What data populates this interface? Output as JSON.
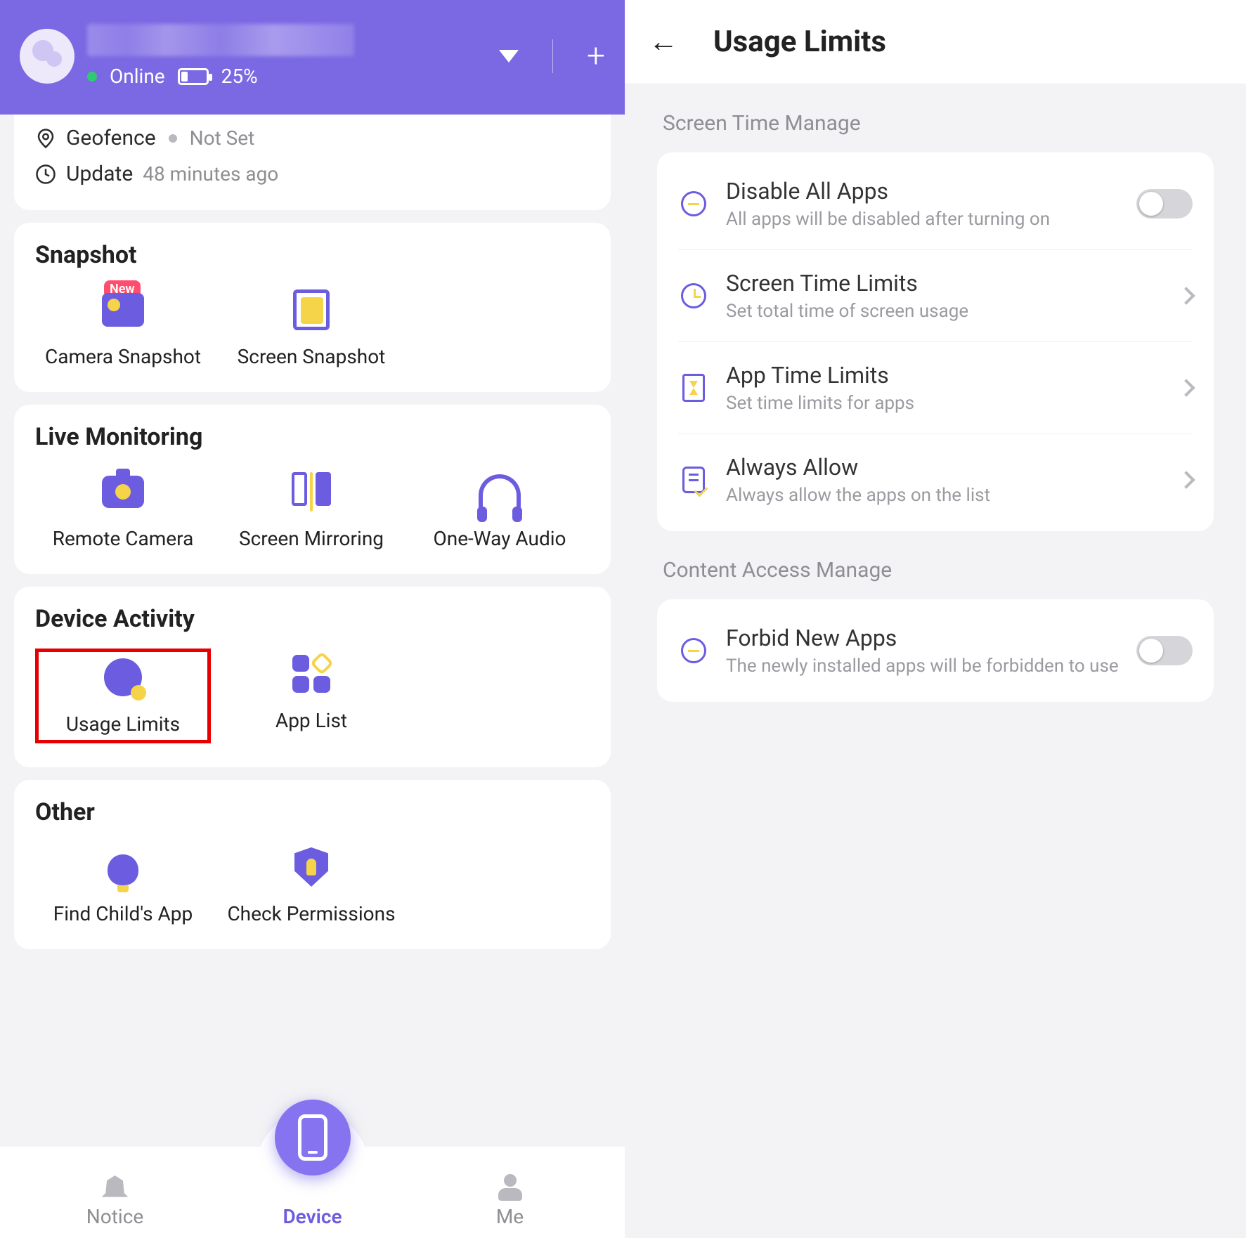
{
  "leftHeader": {
    "status": "Online",
    "battery": "25%"
  },
  "partialCard": {
    "geofence": {
      "label": "Geofence",
      "value": "Not Set"
    },
    "update": {
      "label": "Update",
      "value": "48 minutes ago"
    }
  },
  "sections": {
    "snapshot": {
      "title": "Snapshot",
      "tiles": [
        {
          "label": "Camera Snapshot",
          "badge": "New"
        },
        {
          "label": "Screen Snapshot"
        }
      ]
    },
    "live": {
      "title": "Live Monitoring",
      "tiles": [
        {
          "label": "Remote Camera"
        },
        {
          "label": "Screen Mirroring"
        },
        {
          "label": "One-Way Audio"
        }
      ]
    },
    "activity": {
      "title": "Device Activity",
      "tiles": [
        {
          "label": "Usage Limits"
        },
        {
          "label": "App List"
        }
      ]
    },
    "other": {
      "title": "Other",
      "tiles": [
        {
          "label": "Find Child's App"
        },
        {
          "label": "Check Permissions"
        }
      ]
    }
  },
  "tabbar": {
    "notice": "Notice",
    "device": "Device",
    "me": "Me"
  },
  "rightPage": {
    "title": "Usage Limits",
    "sectionA": "Screen Time Manage",
    "sectionB": "Content Access Manage",
    "rows": {
      "disable": {
        "title": "Disable All Apps",
        "sub": "All apps will be disabled after turning on"
      },
      "screen": {
        "title": "Screen Time Limits",
        "sub": "Set total time of screen usage"
      },
      "app": {
        "title": "App Time Limits",
        "sub": "Set time limits for apps"
      },
      "always": {
        "title": "Always Allow",
        "sub": "Always allow the apps on the list"
      },
      "forbid": {
        "title": "Forbid New Apps",
        "sub": "The newly installed apps will be forbidden to use"
      }
    }
  }
}
